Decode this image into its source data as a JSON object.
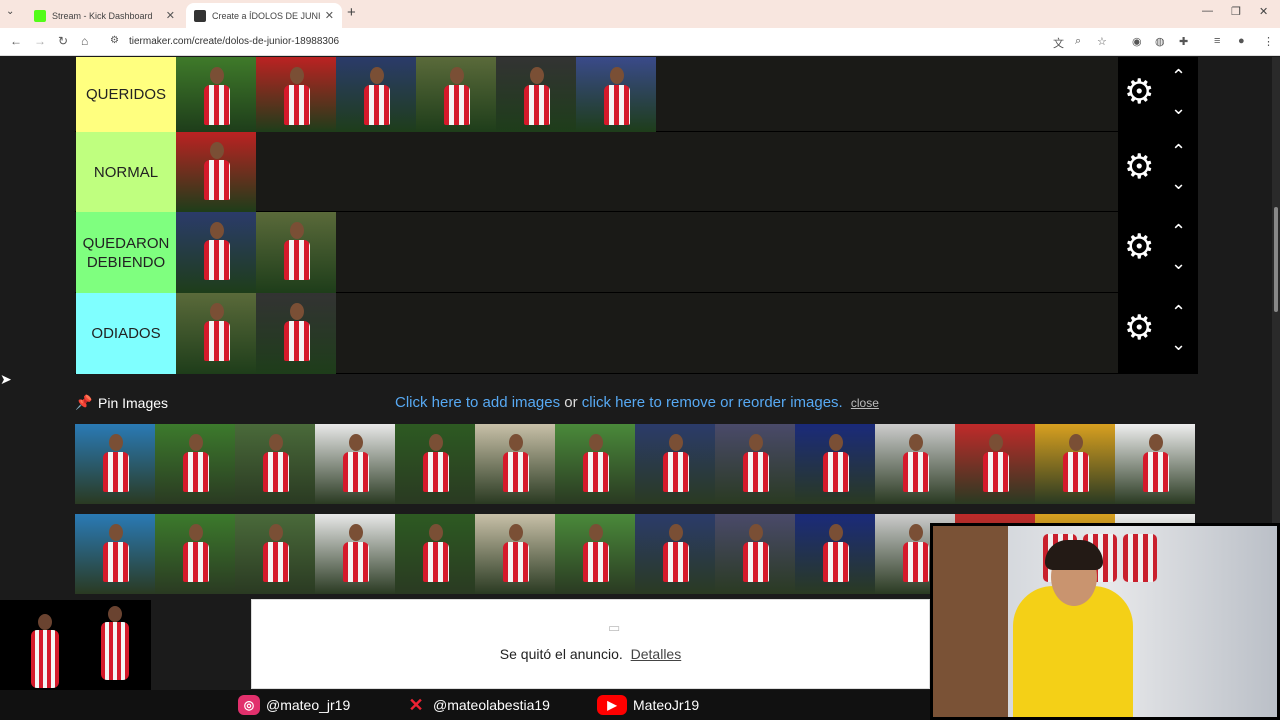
{
  "browser": {
    "tabs": [
      {
        "title": "Stream - Kick Dashboard",
        "favicon_color": "#53fc18",
        "active": false
      },
      {
        "title": "Create a ÍDOLOS DE JUNIOR Tier",
        "favicon_color": "#333333",
        "active": true
      }
    ],
    "url": "tiermaker.com/create/dolos-de-junior-18988306"
  },
  "tiers": [
    {
      "label": "QUERIDOS",
      "color": "#ffff7f",
      "items": 6
    },
    {
      "label": "NORMAL",
      "color": "#bfff7f",
      "items": 1
    },
    {
      "label": "QUEDARON DEBIENDO",
      "color": "#7fff7f",
      "items": 2
    },
    {
      "label": "ODIADOS",
      "color": "#7fffff",
      "items": 2
    }
  ],
  "pin": {
    "title": "Pin Images",
    "add_link": "Click here to add images",
    "or_text": "or",
    "reorder_link": "click here to remove or reorder images.",
    "close": "close"
  },
  "pool": {
    "count": 28
  },
  "ad": {
    "text": "Se quitó el anuncio.",
    "details": "Detalles"
  },
  "social": {
    "instagram": "@mateo_jr19",
    "x": "@mateolabestia19",
    "youtube": "MateoJr19"
  }
}
